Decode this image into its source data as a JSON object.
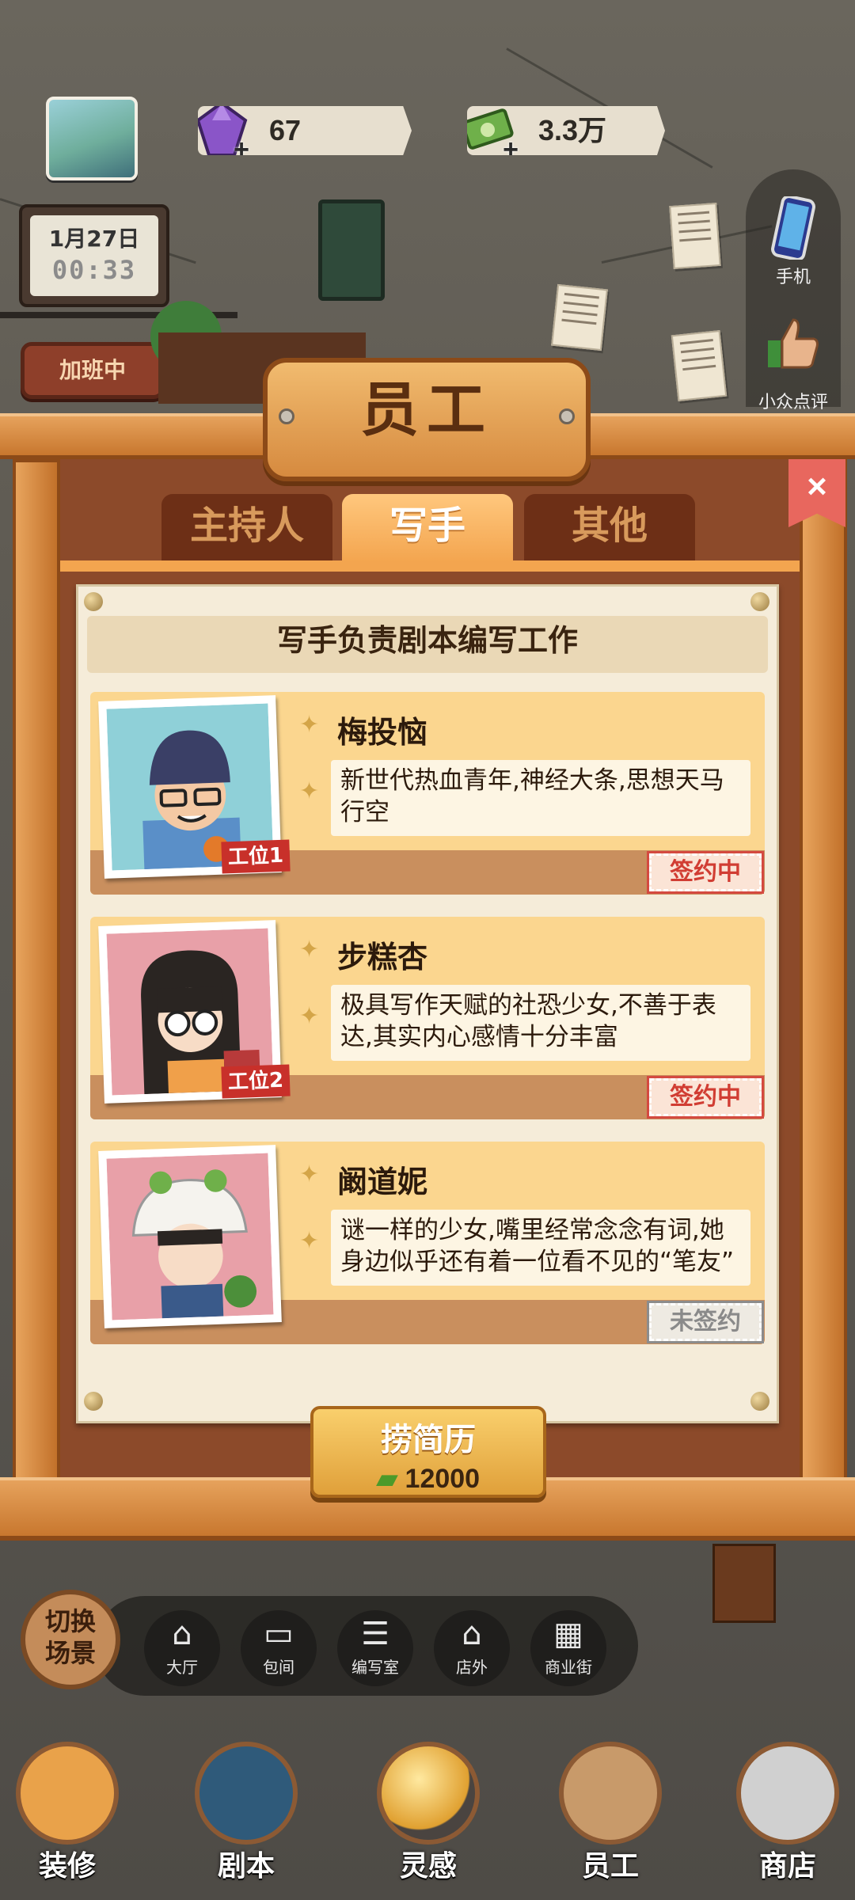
{
  "hud": {
    "gems": "67",
    "cash": "3.3万",
    "date": "1月27日",
    "time": "00:33",
    "overtime_label": "加班中"
  },
  "side": {
    "phone_label": "手机",
    "review_label": "小众点评"
  },
  "panel": {
    "title": "员工",
    "close_icon": "×",
    "tabs": [
      "主持人",
      "写手",
      "其他"
    ],
    "active_tab": "写手",
    "description": "写手负责剧本编写工作"
  },
  "staff": [
    {
      "name": "梅投恼",
      "bio": "新世代热血青年,神经大条,思想天马行空",
      "slot": "工位1",
      "status": "签约中"
    },
    {
      "name": "步糕杏",
      "bio": "极具写作天赋的社恐少女,不善于表达,其实内心感情十分丰富",
      "slot": "工位2",
      "status": "签约中"
    },
    {
      "name": "阚道妮",
      "bio": "谜一样的少女,嘴里经常念念有词,她身边似乎还有着一位看不见的“笔友”",
      "slot": "",
      "status": "未签约"
    }
  ],
  "recruit": {
    "label": "捞简历",
    "cost": "12000"
  },
  "scene": {
    "switch_label": "切换场景",
    "items": [
      "大厅",
      "包间",
      "编写室",
      "店外",
      "商业街"
    ]
  },
  "nav": [
    "装修",
    "剧本",
    "灵感",
    "员工",
    "商店"
  ],
  "icons": {
    "gem": "gem-icon",
    "cash": "cash-icon",
    "phone": "phone-icon",
    "review": "thumbs-up-icon"
  },
  "colors": {
    "signed": "#d13d33",
    "unsigned": "#8a8a8a",
    "tab_active": "#f3a54f"
  }
}
